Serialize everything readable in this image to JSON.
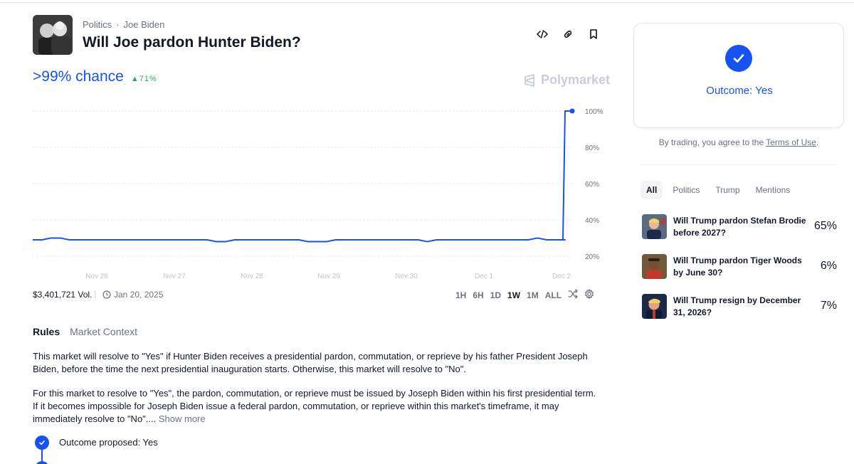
{
  "market": {
    "category": "Politics",
    "subcategory": "Joe Biden",
    "title": "Will Joe pardon Hunter Biden?",
    "chance": ">99% chance",
    "delta": "71%",
    "brand": "Polymarket",
    "volume": "$3,401,721 Vol.",
    "end_date": "Jan 20, 2025"
  },
  "chart_data": {
    "type": "line",
    "x": [
      "Nov 26",
      "Nov 27",
      "Nov 28",
      "Nov 29",
      "Nov 30",
      "Dec 1",
      "Dec 2"
    ],
    "yticks": [
      "100%",
      "80%",
      "60%",
      "40%",
      "20%"
    ],
    "ylim": [
      13,
      100
    ],
    "series": [
      {
        "values": [
          29,
          29,
          30,
          30,
          29,
          29,
          29,
          29,
          29,
          29,
          29,
          29,
          29,
          29,
          29,
          29,
          29,
          29,
          29,
          29,
          28,
          28,
          29,
          29,
          29,
          29,
          29,
          29,
          29,
          29,
          28,
          28,
          28,
          29,
          29,
          29,
          29,
          29,
          29,
          29,
          29,
          29,
          29,
          28,
          29,
          29,
          29,
          29,
          29,
          29,
          29,
          29,
          29,
          29,
          29,
          30,
          29,
          29,
          29,
          100
        ]
      }
    ],
    "colors": {
      "line": "#1652f0",
      "grid": "#e5e7eb"
    },
    "grid": true
  },
  "ranges": {
    "items": [
      "1H",
      "6H",
      "1D",
      "1W",
      "1M",
      "ALL"
    ],
    "active": "1W"
  },
  "tabs": {
    "rules": "Rules",
    "context": "Market Context"
  },
  "rules": {
    "p1": "This market will resolve to \"Yes\" if Hunter Biden receives a presidential pardon, commutation, or reprieve by his father President Joseph Biden, before the time the next presidential inauguration starts. Otherwise, this market will resolve to \"No\".",
    "p2": "For this market to resolve to \"Yes\", the pardon, commutation, or reprieve must be issued by Joseph Biden within his first presidential term. If it becomes impossible for Joseph Biden issue a federal pardon, commutation, or reprieve within this market's timeframe, it may immediately resolve to \"No\"....",
    "show_more": "Show more"
  },
  "timeline": {
    "step1": "Outcome proposed: Yes"
  },
  "sidebar": {
    "outcome": "Outcome: Yes",
    "terms_prefix": "By trading, you agree to the ",
    "terms_link": "Terms of Use",
    "terms_suffix": ".",
    "filters": [
      "All",
      "Politics",
      "Trump",
      "Mentions"
    ],
    "related": [
      {
        "question": "Will Trump pardon Stefan Brodie before 2027?",
        "pct": "65%"
      },
      {
        "question": "Will Trump pardon Tiger Woods by June 30?",
        "pct": "6%"
      },
      {
        "question": "Will Trump resign by December 31, 2026?",
        "pct": "7%"
      }
    ]
  },
  "accent_color": "#1652f0",
  "up_color": "#27ae60"
}
